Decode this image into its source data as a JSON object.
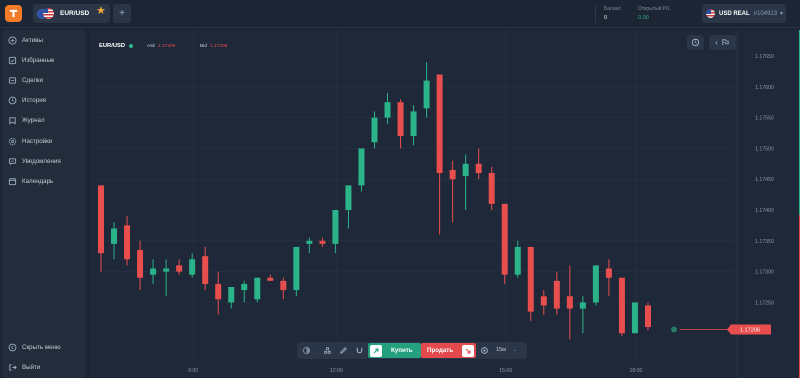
{
  "topbar": {
    "asset_tab_label": "EUR/USD",
    "add_tab_label": "+",
    "balance_label": "Баланс",
    "balance_value": "0",
    "open_pl_label": "Открытый P/L",
    "open_pl_value": "0.00",
    "account_currency": "USD REAL",
    "account_number": "#104913"
  },
  "sidebar": {
    "items": [
      {
        "label": "Активы",
        "icon": "grid-icon"
      },
      {
        "label": "Избранные",
        "icon": "folder-icon"
      },
      {
        "label": "Сделки",
        "icon": "deals-icon"
      },
      {
        "label": "История",
        "icon": "history-icon"
      },
      {
        "label": "Журнал",
        "icon": "journal-icon"
      },
      {
        "label": "Настройки",
        "icon": "gear-icon"
      },
      {
        "label": "Уведомления",
        "icon": "notification-icon"
      },
      {
        "label": "Календарь",
        "icon": "calendar-icon"
      }
    ],
    "hide_menu_label": "Скрыть меню",
    "logout_label": "Выйти"
  },
  "chart_header": {
    "symbol": "EUR/USD",
    "ask_label": "Ask",
    "ask_value": "1.17206",
    "bid_label": "Bid",
    "bid_value": "1.17206"
  },
  "trade_bar": {
    "buy_label": "Купить",
    "sell_label": "Продать",
    "timeframe": "15м"
  },
  "colors": {
    "up": "#2bb389",
    "down": "#e94e4e",
    "buy": "#24a07e",
    "sell": "#e2494c",
    "brand": "#f47b2a"
  },
  "chart_data": {
    "type": "candlestick",
    "symbol": "EUR/USD",
    "current_price": 1.17206,
    "y_ticks": [
      "1.17650",
      "1.17600",
      "1.17550",
      "1.17500",
      "1.17450",
      "1.17400",
      "1.17350",
      "1.17300",
      "1.17250"
    ],
    "current_price_label": "1.17206",
    "x_ticks": [
      "9:00",
      "12:00",
      "15:00",
      "18:00"
    ],
    "ylim": [
      1.17195,
      1.1766
    ],
    "candles": [
      {
        "o": 1.1744,
        "h": 1.1744,
        "l": 1.173,
        "c": 1.1733
      },
      {
        "o": 1.17345,
        "h": 1.1738,
        "l": 1.1732,
        "c": 1.1737
      },
      {
        "o": 1.17375,
        "h": 1.1739,
        "l": 1.1731,
        "c": 1.1732
      },
      {
        "o": 1.17335,
        "h": 1.1735,
        "l": 1.1727,
        "c": 1.1729
      },
      {
        "o": 1.17295,
        "h": 1.1732,
        "l": 1.1728,
        "c": 1.17305
      },
      {
        "o": 1.173,
        "h": 1.1732,
        "l": 1.1726,
        "c": 1.17305
      },
      {
        "o": 1.1731,
        "h": 1.1732,
        "l": 1.17295,
        "c": 1.173
      },
      {
        "o": 1.17295,
        "h": 1.1733,
        "l": 1.1729,
        "c": 1.1732
      },
      {
        "o": 1.17325,
        "h": 1.1734,
        "l": 1.1727,
        "c": 1.1728
      },
      {
        "o": 1.1728,
        "h": 1.173,
        "l": 1.1723,
        "c": 1.17255
      },
      {
        "o": 1.1725,
        "h": 1.1727,
        "l": 1.1724,
        "c": 1.17275
      },
      {
        "o": 1.1727,
        "h": 1.17285,
        "l": 1.1725,
        "c": 1.1728
      },
      {
        "o": 1.17255,
        "h": 1.1729,
        "l": 1.1725,
        "c": 1.1729
      },
      {
        "o": 1.1729,
        "h": 1.17295,
        "l": 1.17285,
        "c": 1.17285
      },
      {
        "o": 1.17285,
        "h": 1.1729,
        "l": 1.17255,
        "c": 1.1727
      },
      {
        "o": 1.1727,
        "h": 1.1732,
        "l": 1.1726,
        "c": 1.1734
      },
      {
        "o": 1.17345,
        "h": 1.17355,
        "l": 1.1733,
        "c": 1.1735
      },
      {
        "o": 1.1735,
        "h": 1.17355,
        "l": 1.1734,
        "c": 1.17345
      },
      {
        "o": 1.17345,
        "h": 1.1739,
        "l": 1.1733,
        "c": 1.174
      },
      {
        "o": 1.174,
        "h": 1.1744,
        "l": 1.1737,
        "c": 1.1744
      },
      {
        "o": 1.1744,
        "h": 1.1749,
        "l": 1.1743,
        "c": 1.175
      },
      {
        "o": 1.1751,
        "h": 1.1756,
        "l": 1.175,
        "c": 1.1755
      },
      {
        "o": 1.1755,
        "h": 1.1759,
        "l": 1.1754,
        "c": 1.17575
      },
      {
        "o": 1.17575,
        "h": 1.1758,
        "l": 1.175,
        "c": 1.1752
      },
      {
        "o": 1.1752,
        "h": 1.1757,
        "l": 1.17505,
        "c": 1.1756
      },
      {
        "o": 1.17565,
        "h": 1.1764,
        "l": 1.1755,
        "c": 1.1761
      },
      {
        "o": 1.1762,
        "h": 1.1762,
        "l": 1.1736,
        "c": 1.1746
      },
      {
        "o": 1.17465,
        "h": 1.1748,
        "l": 1.1738,
        "c": 1.1745
      },
      {
        "o": 1.17455,
        "h": 1.1749,
        "l": 1.174,
        "c": 1.17475
      },
      {
        "o": 1.17475,
        "h": 1.175,
        "l": 1.1745,
        "c": 1.1746
      },
      {
        "o": 1.1746,
        "h": 1.1747,
        "l": 1.174,
        "c": 1.1741
      },
      {
        "o": 1.1741,
        "h": 1.1741,
        "l": 1.1728,
        "c": 1.17295
      },
      {
        "o": 1.17295,
        "h": 1.1735,
        "l": 1.1729,
        "c": 1.1734
      },
      {
        "o": 1.1734,
        "h": 1.1734,
        "l": 1.1722,
        "c": 1.17235
      },
      {
        "o": 1.1726,
        "h": 1.1727,
        "l": 1.1723,
        "c": 1.17245
      },
      {
        "o": 1.17285,
        "h": 1.173,
        "l": 1.1723,
        "c": 1.1724
      },
      {
        "o": 1.1726,
        "h": 1.1731,
        "l": 1.1719,
        "c": 1.1724
      },
      {
        "o": 1.1724,
        "h": 1.1726,
        "l": 1.172,
        "c": 1.1725
      },
      {
        "o": 1.1725,
        "h": 1.173,
        "l": 1.17245,
        "c": 1.1731
      },
      {
        "o": 1.17305,
        "h": 1.1732,
        "l": 1.1726,
        "c": 1.1729
      },
      {
        "o": 1.1729,
        "h": 1.1729,
        "l": 1.17195,
        "c": 1.172
      },
      {
        "o": 1.172,
        "h": 1.17245,
        "l": 1.172,
        "c": 1.1725
      },
      {
        "o": 1.17245,
        "h": 1.1725,
        "l": 1.17205,
        "c": 1.1721
      },
      {
        "o": 1.17206,
        "h": 1.17216,
        "l": 1.17196,
        "c": 1.17206
      }
    ]
  }
}
